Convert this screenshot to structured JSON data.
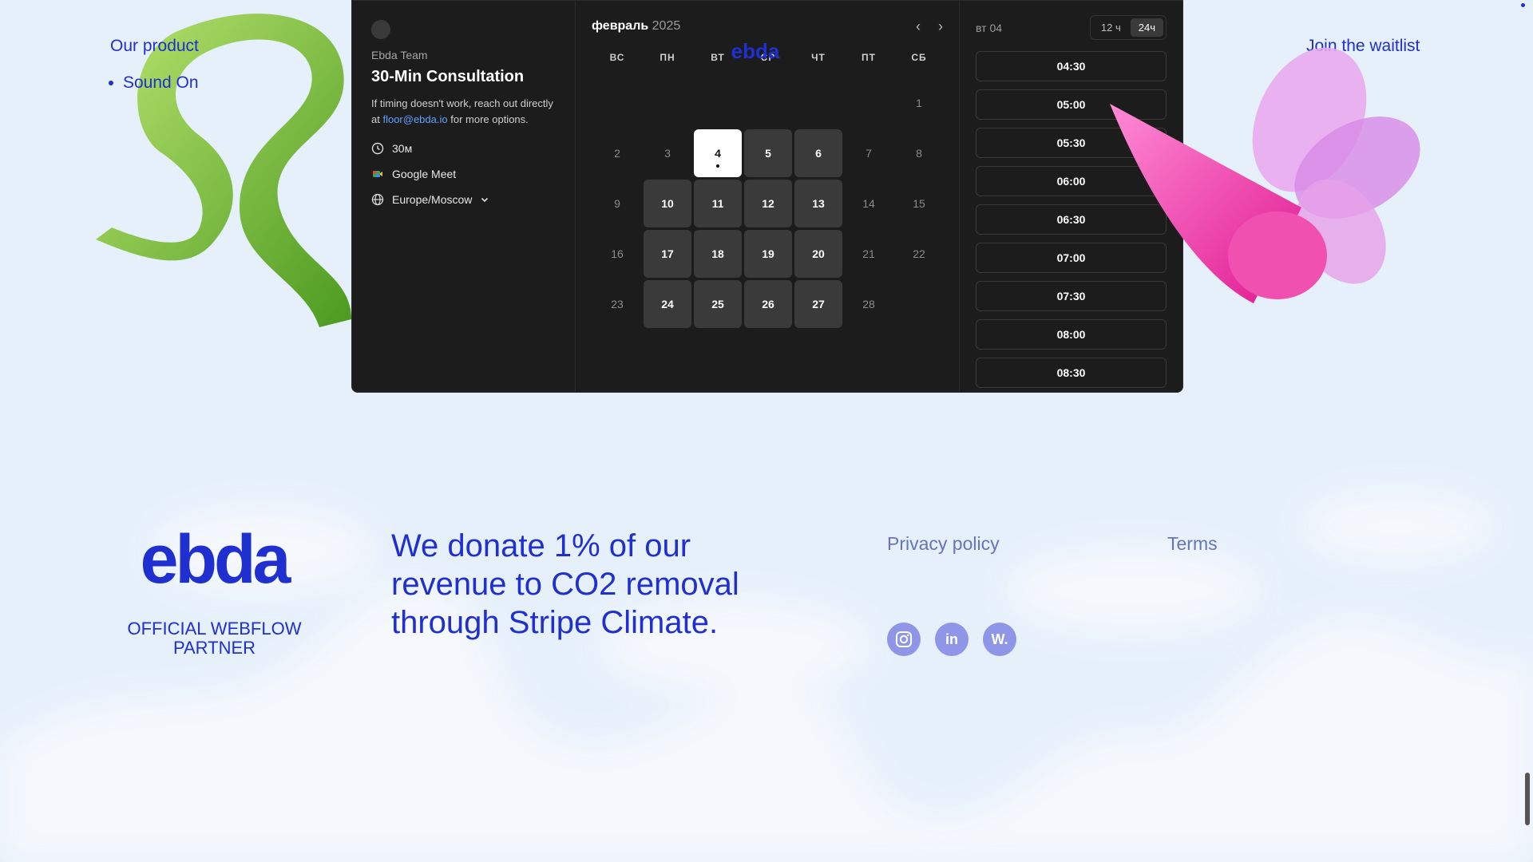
{
  "nav": {
    "our_product": "Our product",
    "items": [
      {
        "label": "Sound On"
      }
    ],
    "join": "Join the waitlist"
  },
  "widget": {
    "team": "Ebda Team",
    "title": "30-Min Consultation",
    "desc_before": "If timing doesn't work, reach out directly at ",
    "email": "floor@ebda.io",
    "desc_after": " for more options.",
    "duration": "30м",
    "location": "Google Meet",
    "timezone": "Europe/Moscow",
    "month": "февраль",
    "year": "2025",
    "weekdays": [
      "ВС",
      "ПН",
      "ВТ",
      "СР",
      "ЧТ",
      "ПТ",
      "СБ"
    ],
    "days": [
      "",
      "",
      "",
      "",
      "",
      "",
      "1",
      "2",
      "3",
      "4",
      "5",
      "6",
      "7",
      "8",
      "9",
      "10",
      "11",
      "12",
      "13",
      "14",
      "15",
      "16",
      "17",
      "18",
      "19",
      "20",
      "21",
      "22",
      "23",
      "24",
      "25",
      "26",
      "27",
      "28",
      ""
    ],
    "selected_day": "4",
    "available_days": [
      "5",
      "6",
      "10",
      "11",
      "12",
      "13",
      "17",
      "18",
      "19",
      "20",
      "24",
      "25",
      "26",
      "27"
    ],
    "slot_weekday": "вт",
    "slot_day": "04",
    "toggle_12": "12 ч",
    "toggle_24": "24ч",
    "slots": [
      "04:30",
      "05:00",
      "05:30",
      "06:00",
      "06:30",
      "07:00",
      "07:30",
      "08:00",
      "08:30"
    ]
  },
  "footer": {
    "partner": "OFFICIAL WEBFLOW PARTNER",
    "donate": "We donate 1% of our revenue to CO2 removal through Stripe Climate.",
    "privacy": "Privacy policy",
    "terms": "Terms",
    "socials": [
      {
        "name": "instagram-icon",
        "glyph": ""
      },
      {
        "name": "linkedin-icon",
        "glyph": "in"
      },
      {
        "name": "webflow-icon",
        "glyph": "W."
      }
    ]
  },
  "colors": {
    "brand": "#1f2fd0",
    "widget_bg": "#1c1c1c"
  }
}
